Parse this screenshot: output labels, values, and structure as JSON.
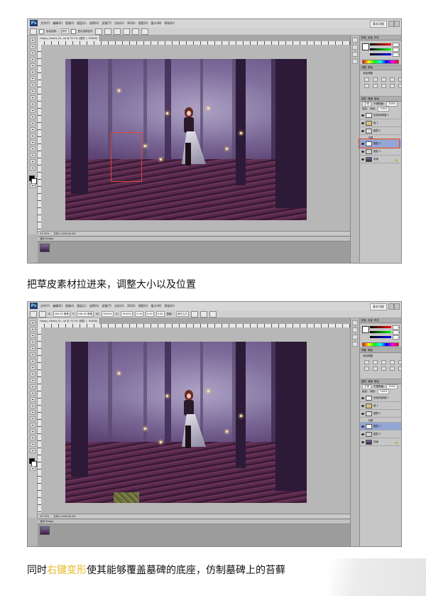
{
  "colors": {
    "highlight_text": "#e8b820",
    "selection_red": "#e0443a",
    "selected_layer": "#93a6d6"
  },
  "screenshots": [
    {
      "app_logo": "Ps",
      "menu": [
        "文件(F)",
        "编辑(E)",
        "图像(I)",
        "图层(L)",
        "选择(S)",
        "滤镜(T)",
        "分析(A)",
        "3D(D)",
        "视图(V)",
        "窗口(W)",
        "帮助(H)"
      ],
      "workspace": "基本功能",
      "options": {
        "auto_select_label": "自动选择：",
        "auto_select_value": "图层",
        "transform_controls_label": "显示变换控件"
      },
      "doc_tab": "Happy_Hearts_Ri...sd @ 33.3% (图层 1, RGB/8)",
      "zoom": "33.33%",
      "doc_info": "文档:2.00M/28.4M",
      "bottom_header": "迷你 Bridge",
      "panel_tabs": {
        "color": [
          "颜色",
          "色板",
          "样式"
        ],
        "adjustments": [
          "调整",
          "蒙版"
        ],
        "layers": [
          "图层",
          "通道",
          "路径"
        ]
      },
      "color_values": [
        "0",
        "0",
        "0"
      ],
      "adjustments_title": "添加调整",
      "layers_controls": {
        "blend_mode": "正常",
        "opacity_label": "不透明度:",
        "opacity": "100%",
        "lock_label": "锁定:",
        "fill_label": "填充:",
        "fill": "100%"
      },
      "layers": [
        {
          "name": "色相/饱和度 1",
          "type": "adjustment"
        },
        {
          "name": "组 1",
          "type": "group"
        },
        {
          "name": "图层 2",
          "type": "normal"
        },
        {
          "name": "效果",
          "type": "effect"
        },
        {
          "name": "图层 1",
          "type": "normal",
          "selected": true
        },
        {
          "name": "图层 3",
          "type": "normal"
        },
        {
          "name": "背景",
          "type": "background"
        }
      ]
    },
    {
      "app_logo": "Ps",
      "menu": [
        "文件(F)",
        "编辑(E)",
        "图像(I)",
        "图层(L)",
        "选择(S)",
        "滤镜(T)",
        "分析(A)",
        "3D(D)",
        "视图(V)",
        "窗口(W)",
        "帮助(H)"
      ],
      "workspace": "基本功能",
      "options": {
        "x_label": "X:",
        "x": "264.00 像素",
        "y_label": "Y:",
        "y": "548.00 像素",
        "w_label": "W:",
        "w": "76.60%",
        "h_label": "H:",
        "h": "76.60%",
        "angle": "0.00",
        "h_skew": "0.00",
        "v_skew": "0.00",
        "interp_label": "插值：",
        "interp": "两次立方"
      },
      "doc_tab": "Happy_Hearts_Ri...sd @ 33.3% (图层 1, RGB/8)",
      "zoom": "33.33%",
      "doc_info": "文档:2.00M/28.4M",
      "bottom_header": "迷你 Bridge",
      "panel_tabs": {
        "color": [
          "颜色",
          "色板",
          "样式"
        ],
        "adjustments": [
          "调整",
          "蒙版"
        ],
        "layers": [
          "图层",
          "通道",
          "路径"
        ]
      },
      "color_values": [
        "0",
        "0",
        "0"
      ],
      "adjustments_title": "添加调整",
      "layers_controls": {
        "blend_mode": "正常",
        "opacity_label": "不透明度:",
        "opacity": "100%",
        "lock_label": "锁定:",
        "fill_label": "填充:",
        "fill": "100%"
      },
      "layers": [
        {
          "name": "色相/饱和度 1",
          "type": "adjustment"
        },
        {
          "name": "组 1",
          "type": "group"
        },
        {
          "name": "图层 2",
          "type": "normal"
        },
        {
          "name": "效果",
          "type": "effect"
        },
        {
          "name": "图层 1",
          "type": "normal",
          "selected": true
        },
        {
          "name": "图层 3",
          "type": "normal"
        },
        {
          "name": "背景",
          "type": "background"
        }
      ]
    }
  ],
  "captions": {
    "caption1": "把草皮素材拉进来，调整大小以及位置",
    "caption2_prefix": "同时",
    "caption2_highlight": "右键变形",
    "caption2_suffix": "使其能够覆盖墓碑的底座，仿制墓碑上的苔藓"
  }
}
